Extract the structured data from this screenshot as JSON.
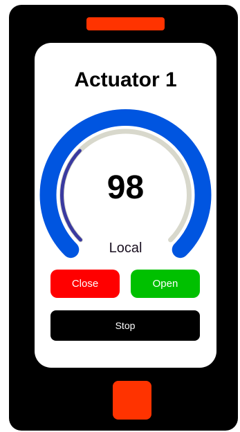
{
  "device": {
    "accent_color": "#ff3300"
  },
  "screen": {
    "title": "Actuator 1",
    "gauge": {
      "value": "98",
      "value_fraction": 0.98,
      "track_color": "#0055e0",
      "inner_track_color": "#d8d8cc",
      "progress_color": "#3a3aa0"
    },
    "mode_label": "Local",
    "buttons": {
      "close_label": "Close",
      "close_color": "#ff0000",
      "open_label": "Open",
      "open_color": "#00c000",
      "stop_label": "Stop",
      "stop_color": "#000000"
    }
  }
}
